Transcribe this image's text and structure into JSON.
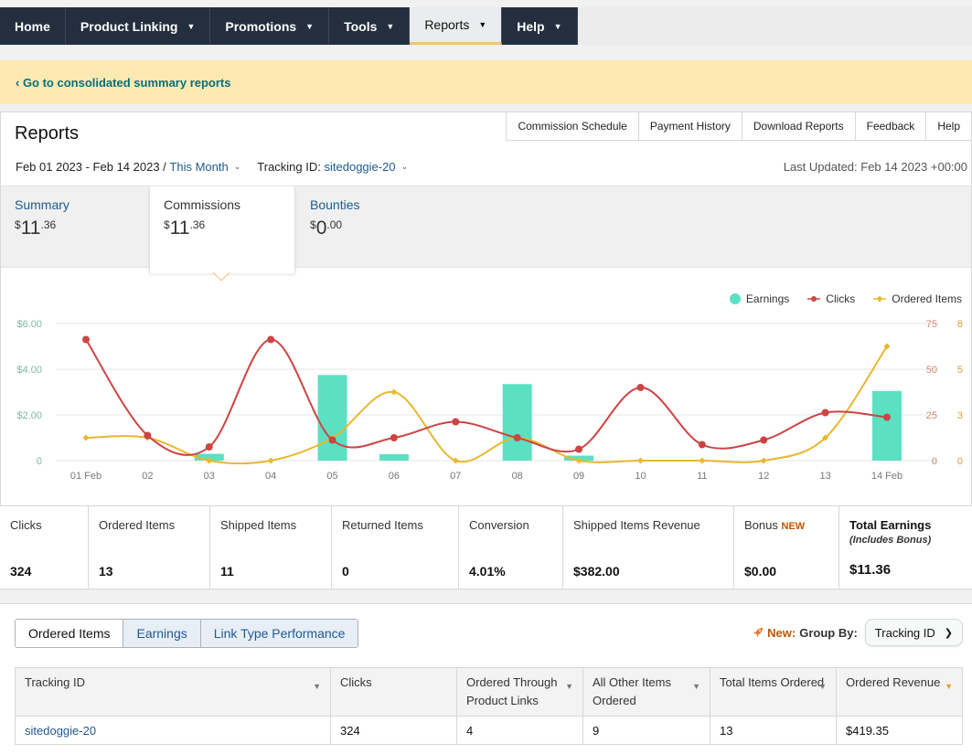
{
  "nav": {
    "items": [
      {
        "label": "Home",
        "dropdown": false
      },
      {
        "label": "Product Linking",
        "dropdown": true
      },
      {
        "label": "Promotions",
        "dropdown": true
      },
      {
        "label": "Tools",
        "dropdown": true
      },
      {
        "label": "Reports",
        "dropdown": true,
        "active": true
      },
      {
        "label": "Help",
        "dropdown": true
      }
    ]
  },
  "banner": {
    "link": "‹ Go to consolidated summary reports"
  },
  "header": {
    "title": "Reports",
    "links": [
      "Commission Schedule",
      "Payment History",
      "Download Reports",
      "Feedback",
      "Help"
    ],
    "date_range": "Feb 01 2023 - Feb 14 2023 / ",
    "period": "This Month",
    "tracking_label": "Tracking ID: ",
    "tracking_value": "sitedoggie-20",
    "last_updated": "Last Updated: Feb 14 2023 +00:00"
  },
  "summary_tabs": [
    {
      "label": "Summary",
      "currency": "$",
      "whole": "11",
      "cents": ".36"
    },
    {
      "label": "Commissions",
      "currency": "$",
      "whole": "11",
      "cents": ".36",
      "active": true
    },
    {
      "label": "Bounties",
      "currency": "$",
      "whole": "0",
      "cents": ".00"
    }
  ],
  "legend": {
    "earnings": "Earnings",
    "clicks": "Clicks",
    "ordered": "Ordered Items"
  },
  "colors": {
    "earnings": "#5be0c2",
    "clicks": "#cc4444",
    "ordered": "#e8b830",
    "nav_bg": "#232f3e",
    "link": "#1f5a8f"
  },
  "chart_data": {
    "type": "bar",
    "categories": [
      "01 Feb",
      "02",
      "03",
      "04",
      "05",
      "06",
      "07",
      "08",
      "09",
      "10",
      "11",
      "12",
      "13",
      "14 Feb"
    ],
    "series": [
      {
        "name": "Earnings",
        "type": "bar",
        "axis": "left",
        "values": [
          0,
          0,
          0.3,
          0,
          3.75,
          0.28,
          0,
          3.35,
          0.22,
          0,
          0,
          0,
          0,
          3.05
        ]
      },
      {
        "name": "Clicks",
        "type": "line",
        "axis": "right",
        "values": [
          53,
          11,
          6,
          53,
          9,
          10,
          17,
          10,
          5,
          32,
          7,
          9,
          21,
          19
        ]
      },
      {
        "name": "Ordered Items",
        "type": "line",
        "axis": "right2",
        "values": [
          1,
          1,
          0,
          0,
          1,
          3,
          0,
          1,
          0,
          0,
          0,
          0,
          1,
          5
        ]
      }
    ],
    "y_left": {
      "ticks": [
        "$6.00",
        "$4.00",
        "$2.00",
        "0"
      ],
      "range": [
        0,
        6
      ]
    },
    "y_right": {
      "ticks": [
        "75",
        "50",
        "25",
        "0"
      ],
      "range": [
        0,
        75
      ]
    },
    "y_right2": {
      "ticks": [
        "8",
        "5",
        "3",
        "0"
      ],
      "range": [
        0,
        8
      ]
    },
    "grid": true,
    "legend_position": "top-right"
  },
  "stats": [
    {
      "label": "Clicks",
      "value": "324"
    },
    {
      "label": "Ordered Items",
      "value": "13"
    },
    {
      "label": "Shipped Items",
      "value": "11"
    },
    {
      "label": "Returned Items",
      "value": "0"
    },
    {
      "label": "Conversion",
      "value": "4.01%"
    },
    {
      "label": "Shipped Items Revenue",
      "value": "$382.00"
    },
    {
      "label": "Bonus",
      "badge": "NEW",
      "value": "$0.00"
    },
    {
      "label": "Total Earnings",
      "sub": "(Includes Bonus)",
      "value": "$11.36"
    }
  ],
  "bottom_tabs": [
    "Ordered Items",
    "Earnings",
    "Link Type Performance"
  ],
  "group_by": {
    "new_label": "New:",
    "label": "Group By:",
    "value": "Tracking ID"
  },
  "table": {
    "columns": [
      "Tracking ID",
      "Clicks",
      "Ordered Through Product Links",
      "All Other Items Ordered",
      "Total Items Ordered",
      "Ordered Revenue"
    ],
    "rows": [
      [
        "sitedoggie-20",
        "324",
        "4",
        "9",
        "13",
        "$419.35"
      ]
    ]
  }
}
